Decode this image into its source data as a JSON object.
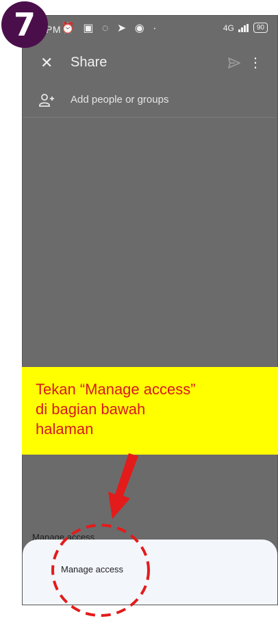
{
  "step_badge": "7",
  "status_bar": {
    "time": "PM",
    "left_icons": "⏰ ▣ ◌ ➤ ◉ ·",
    "network_label": "4G",
    "battery": "90"
  },
  "app_bar": {
    "title": "Share",
    "close_icon": "close-icon",
    "send_icon": "send-icon",
    "more_icon": "more-vert-icon"
  },
  "add_people": {
    "label": "Add people or groups",
    "icon": "add-person-icon"
  },
  "behind_sheet_label": "Manage access",
  "bottom_sheet": {
    "item_label": "Manage access"
  },
  "callout": {
    "text": "Tekan “Manage access”\ndi bagian bawah\nhalaman"
  },
  "colors": {
    "overlay": "#6b6b6b",
    "badge": "#4a0f4a",
    "callout_bg": "#ffff00",
    "callout_text": "#d71920",
    "annotation": "#e31b1b",
    "sheet_bg": "#f3f6fb"
  }
}
